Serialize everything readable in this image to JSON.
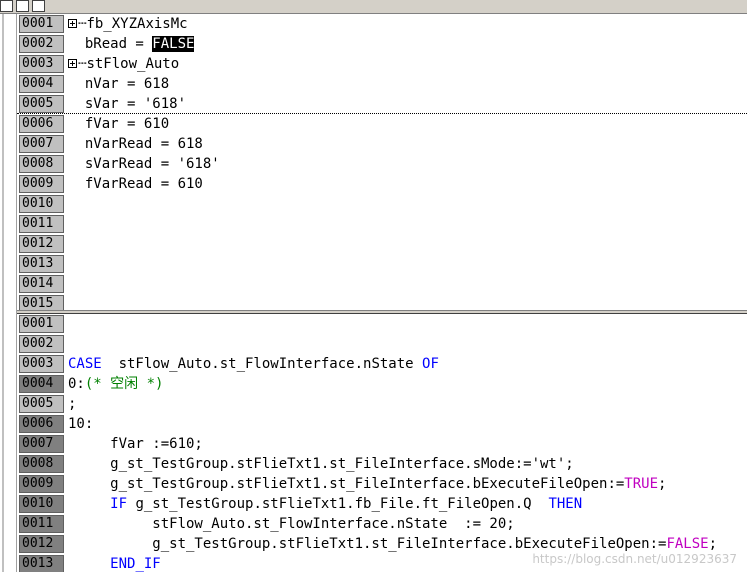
{
  "editor": {
    "top_pane": {
      "lines": [
        {
          "n": "0001",
          "segments": [
            {
              "t": "fb_XYZAxisMc",
              "c": "plain"
            }
          ],
          "expander": true
        },
        {
          "n": "0002",
          "segments": [
            {
              "t": "bRead = ",
              "c": "plain"
            },
            {
              "t": "FALSE",
              "c": "hl"
            }
          ]
        },
        {
          "n": "0003",
          "segments": [
            {
              "t": "stFlow_Auto",
              "c": "plain"
            }
          ],
          "expander": true
        },
        {
          "n": "0004",
          "segments": [
            {
              "t": "nVar = 618",
              "c": "plain"
            }
          ]
        },
        {
          "n": "0005",
          "segments": [
            {
              "t": "sVar = '618'",
              "c": "plain"
            }
          ],
          "dotted": true
        },
        {
          "n": "0006",
          "segments": [
            {
              "t": "fVar = 610",
              "c": "plain"
            }
          ]
        },
        {
          "n": "0007",
          "segments": [
            {
              "t": "nVarRead = 618",
              "c": "plain"
            }
          ]
        },
        {
          "n": "0008",
          "segments": [
            {
              "t": "sVarRead = '618'",
              "c": "plain"
            }
          ]
        },
        {
          "n": "0009",
          "segments": [
            {
              "t": "fVarRead = 610",
              "c": "plain"
            }
          ]
        },
        {
          "n": "0010",
          "segments": []
        },
        {
          "n": "0011",
          "segments": []
        },
        {
          "n": "0012",
          "segments": []
        },
        {
          "n": "0013",
          "segments": []
        },
        {
          "n": "0014",
          "segments": []
        },
        {
          "n": "0015",
          "segments": []
        }
      ]
    },
    "bottom_pane": {
      "lines": [
        {
          "n": "0001",
          "dark": false,
          "segments": []
        },
        {
          "n": "0002",
          "dark": false,
          "segments": []
        },
        {
          "n": "0003",
          "dark": false,
          "segments": [
            {
              "t": "CASE",
              "c": "kw"
            },
            {
              "t": "  stFlow_Auto.st_FlowInterface.nState ",
              "c": "plain"
            },
            {
              "t": "OF",
              "c": "kw"
            }
          ]
        },
        {
          "n": "0004",
          "dark": true,
          "segments": [
            {
              "t": "0:",
              "c": "plain"
            },
            {
              "t": "(* 空闲 *)",
              "c": "cm"
            }
          ]
        },
        {
          "n": "0005",
          "dark": false,
          "segments": [
            {
              "t": ";",
              "c": "plain"
            }
          ]
        },
        {
          "n": "0006",
          "dark": true,
          "segments": [
            {
              "t": "10:",
              "c": "plain"
            }
          ]
        },
        {
          "n": "0007",
          "dark": true,
          "segments": [
            {
              "t": "     fVar :=610;",
              "c": "plain"
            }
          ]
        },
        {
          "n": "0008",
          "dark": true,
          "segments": [
            {
              "t": "     g_st_TestGroup.stFlieTxt1.st_FileInterface.sMode:='wt';",
              "c": "plain"
            }
          ]
        },
        {
          "n": "0009",
          "dark": true,
          "segments": [
            {
              "t": "     g_st_TestGroup.stFlieTxt1.st_FileInterface.bExecuteFileOpen:=",
              "c": "plain"
            },
            {
              "t": "TRUE",
              "c": "kw2"
            },
            {
              "t": ";",
              "c": "plain"
            }
          ]
        },
        {
          "n": "0010",
          "dark": true,
          "segments": [
            {
              "t": "     ",
              "c": "plain"
            },
            {
              "t": "IF",
              "c": "kw"
            },
            {
              "t": " g_st_TestGroup.stFlieTxt1.fb_File.ft_FileOpen.Q  ",
              "c": "plain"
            },
            {
              "t": "THEN",
              "c": "kw"
            }
          ]
        },
        {
          "n": "0011",
          "dark": true,
          "segments": [
            {
              "t": "          stFlow_Auto.st_FlowInterface.nState  := 20;",
              "c": "plain"
            }
          ]
        },
        {
          "n": "0012",
          "dark": true,
          "segments": [
            {
              "t": "          g_st_TestGroup.stFlieTxt1.st_FileInterface.bExecuteFileOpen:=",
              "c": "plain"
            },
            {
              "t": "FALSE",
              "c": "kw2"
            },
            {
              "t": ";",
              "c": "plain"
            }
          ]
        },
        {
          "n": "0013",
          "dark": true,
          "segments": [
            {
              "t": "     ",
              "c": "plain"
            },
            {
              "t": "END_IF",
              "c": "kw"
            }
          ]
        }
      ]
    },
    "watermark": "https://blog.csdn.net/u012923637"
  },
  "colors": {
    "keyword": "#0000ff",
    "bool_literal": "#c000c0",
    "comment": "#008000"
  }
}
